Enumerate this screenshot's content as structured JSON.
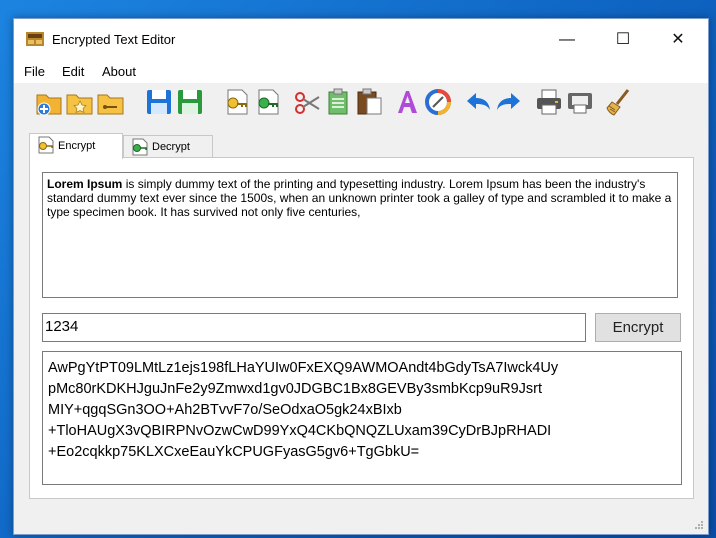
{
  "window": {
    "title": "Encrypted Text Editor",
    "minimize_glyph": "—",
    "maximize_glyph": "☐",
    "close_glyph": "✕"
  },
  "menu": {
    "items": [
      "File",
      "Edit",
      "About"
    ]
  },
  "toolbar": {
    "icons": [
      "new-file-icon",
      "open-file-icon",
      "open-folder-icon",
      "save-icon",
      "save-as-icon",
      "encrypt-file-icon",
      "decrypt-file-icon",
      "cut-icon",
      "copy-icon",
      "paste-icon",
      "font-icon",
      "color-icon",
      "undo-icon",
      "redo-icon",
      "print-icon",
      "print-preview-icon",
      "clear-icon"
    ]
  },
  "tabs": [
    {
      "label": "Encrypt",
      "active": true
    },
    {
      "label": "Decrypt",
      "active": false
    }
  ],
  "editor": {
    "bold_lead": "Lorem Ipsum",
    "text_rest": " is simply dummy text of the printing and typesetting industry. Lorem Ipsum has been the industry's standard dummy text ever since the 1500s, when an unknown printer took a galley of type and scrambled it to make a type specimen book. It has survived not only five centuries,"
  },
  "password": {
    "value": "1234"
  },
  "encrypt_button": {
    "label": "Encrypt"
  },
  "cipher_output": {
    "lines": [
      "AwPgYtPT09LMtLz1ejs198fLHaYUIw0FxEXQ9AWMOAndt4bGdyTsA7Iwck4Uy",
      "pMc80rKDKHJguJnFe2y9Zmwxd1gv0JDGBC1Bx8GEVBy3smbKcp9uR9Jsrt",
      "MIY+qgqSGn3OO+Ah2BTvvF7o/SeOdxaO5gk24xBIxb",
      "+TloHAUgX3vQBIRPNvOzwCwD99YxQ4CKbQNQZLUxam39CyDrBJpRHADI",
      "+Eo2cqkkp75KLXCxeEauYkCPUGFyasG5gv6+TgGbkU="
    ]
  },
  "colors": {
    "desktop": "#1565b8",
    "window_bg": "#f0f0f0",
    "accent_blue": "#1e73d6"
  }
}
